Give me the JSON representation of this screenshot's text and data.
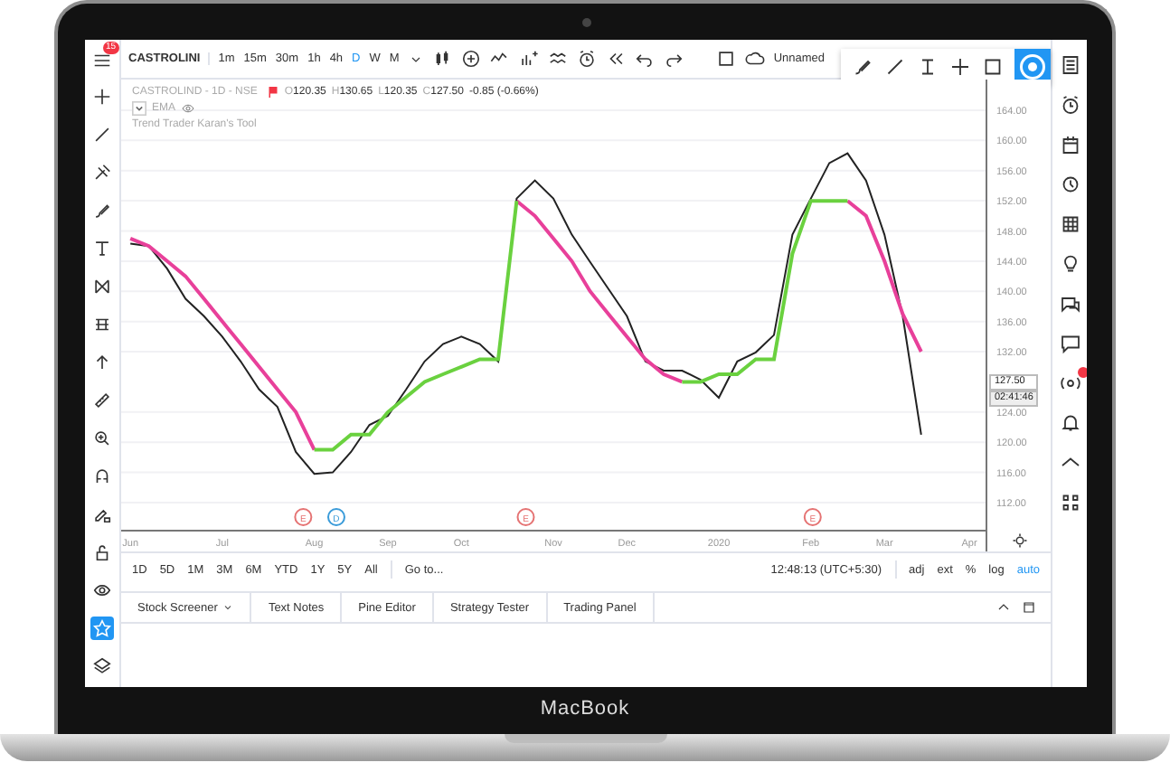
{
  "laptop": {
    "brand": "MacBook"
  },
  "toolbar": {
    "menu_badge": "15",
    "symbol": "CASTROLINI",
    "intervals": [
      {
        "label": "1m",
        "selected": false
      },
      {
        "label": "15m",
        "selected": false
      },
      {
        "label": "30m",
        "selected": false
      },
      {
        "label": "1h",
        "selected": false
      },
      {
        "label": "4h",
        "selected": false
      },
      {
        "label": "D",
        "selected": true
      },
      {
        "label": "W",
        "selected": false
      },
      {
        "label": "M",
        "selected": false
      }
    ],
    "layout_name": "Unnamed"
  },
  "drawing_tools": [
    {
      "selected": false
    },
    {
      "selected": false
    },
    {
      "selected": false
    },
    {
      "selected": false
    },
    {
      "selected": false
    },
    {
      "selected": false
    },
    {
      "selected": false
    },
    {
      "selected": false
    },
    {
      "selected": false
    },
    {
      "selected": false
    },
    {
      "selected": false
    },
    {
      "selected": false
    },
    {
      "selected": false
    },
    {
      "selected": false
    },
    {
      "selected": true
    },
    {
      "selected": false
    }
  ],
  "legend": {
    "title": "CASTROLIND - 1D - NSE",
    "ohlc": [
      {
        "label": "O",
        "value": "120.35"
      },
      {
        "label": "H",
        "value": "130.65"
      },
      {
        "label": "L",
        "value": "120.35"
      },
      {
        "label": "C",
        "value": "127.50"
      }
    ],
    "change": "-0.85 (-0.66%)",
    "studies": [
      {
        "name": "EMA",
        "controls": true
      },
      {
        "name": "Trend Trader Karan's Tool",
        "controls": false
      }
    ]
  },
  "chart": {
    "price_label": "127.50",
    "countdown": "02:41:46",
    "events": [
      {
        "label": "E",
        "color": "#e57373"
      },
      {
        "label": "D",
        "color": "#3a9bd9"
      },
      {
        "label": "E",
        "color": "#e57373"
      },
      {
        "label": "E",
        "color": "#e57373"
      }
    ],
    "chart_data": {
      "type": "line",
      "categories": [
        "Jun",
        null,
        null,
        null,
        null,
        "Jul",
        null,
        null,
        null,
        null,
        "Aug",
        null,
        null,
        null,
        "Sep",
        null,
        null,
        null,
        "Oct",
        null,
        null,
        null,
        null,
        "Nov",
        null,
        null,
        null,
        "Dec",
        null,
        null,
        null,
        null,
        "2020",
        null,
        null,
        null,
        null,
        "Feb",
        null,
        null,
        null,
        "Mar",
        null,
        null,
        null,
        null,
        "Apr"
      ],
      "series": [
        {
          "color": "#222222",
          "values": [
            146.3,
            146,
            143,
            139,
            136.7,
            134,
            130.7,
            127,
            124.7,
            118.7,
            115.8,
            116,
            118.7,
            122.3,
            123.5,
            127,
            130.7,
            133,
            134,
            133,
            130.7,
            152.3,
            154.7,
            152.3,
            147.5,
            143.9,
            140.3,
            136.7,
            130.7,
            129.5,
            129.5,
            128.3,
            125.9,
            130.7,
            131.9,
            134.2,
            147.5,
            152.3,
            157,
            158.3,
            154.7,
            147.5,
            136.7,
            121,
            null,
            null,
            null
          ]
        },
        {
          "color": "#e8409a",
          "values": [
            147,
            146,
            144,
            142,
            139,
            136,
            133,
            130,
            127,
            124,
            119,
            null,
            null,
            null,
            null,
            null,
            null,
            null,
            null,
            null,
            null,
            152,
            150,
            147,
            144,
            140,
            137,
            134,
            131,
            129,
            128,
            null,
            null,
            null,
            null,
            null,
            null,
            null,
            null,
            152,
            150,
            144,
            137,
            132,
            null,
            null,
            null
          ]
        },
        {
          "color": "#6ad13f",
          "values": [
            null,
            null,
            null,
            null,
            null,
            null,
            null,
            null,
            null,
            null,
            119,
            119,
            121,
            121,
            124,
            126,
            128,
            129,
            130,
            131,
            131,
            152,
            null,
            null,
            null,
            null,
            null,
            null,
            null,
            null,
            128,
            128,
            129,
            129,
            131,
            131,
            145,
            152,
            152,
            152,
            null,
            null,
            null,
            null,
            null,
            null,
            null
          ]
        }
      ],
      "ylim": [
        108.4,
        168.07
      ],
      "grid": true,
      "yticks": [
        {
          "value": 112,
          "label": "112.00"
        },
        {
          "value": 116,
          "label": "116.00"
        },
        {
          "value": 120,
          "label": "120.00"
        },
        {
          "value": 124,
          "label": "124.00"
        },
        {
          "value": 132,
          "label": "132.00"
        },
        {
          "value": 136,
          "label": "136.00"
        },
        {
          "value": 140,
          "label": "140.00"
        },
        {
          "value": 144,
          "label": "144.00"
        },
        {
          "value": 148,
          "label": "148.00"
        },
        {
          "value": 152,
          "label": "152.00"
        },
        {
          "value": 156,
          "label": "156.00"
        },
        {
          "value": 160,
          "label": "160.00"
        },
        {
          "value": 164,
          "label": "164.00"
        }
      ]
    }
  },
  "range_bar": {
    "ranges": [
      "1D",
      "5D",
      "1M",
      "3M",
      "6M",
      "YTD",
      "1Y",
      "5Y",
      "All"
    ],
    "goto": "Go to...",
    "clock": "12:48:13 (UTC+5:30)",
    "scale_options": [
      {
        "label": "adj",
        "selected": false
      },
      {
        "label": "ext",
        "selected": false
      },
      {
        "label": "%",
        "selected": false
      },
      {
        "label": "log",
        "selected": false
      },
      {
        "label": "auto",
        "selected": true
      }
    ]
  },
  "bottom_tabs": [
    {
      "label": "Stock Screener",
      "dropdown": true
    },
    {
      "label": "Text Notes",
      "dropdown": false
    },
    {
      "label": "Pine Editor",
      "dropdown": false
    },
    {
      "label": "Strategy Tester",
      "dropdown": false
    },
    {
      "label": "Trading Panel",
      "dropdown": false
    }
  ]
}
